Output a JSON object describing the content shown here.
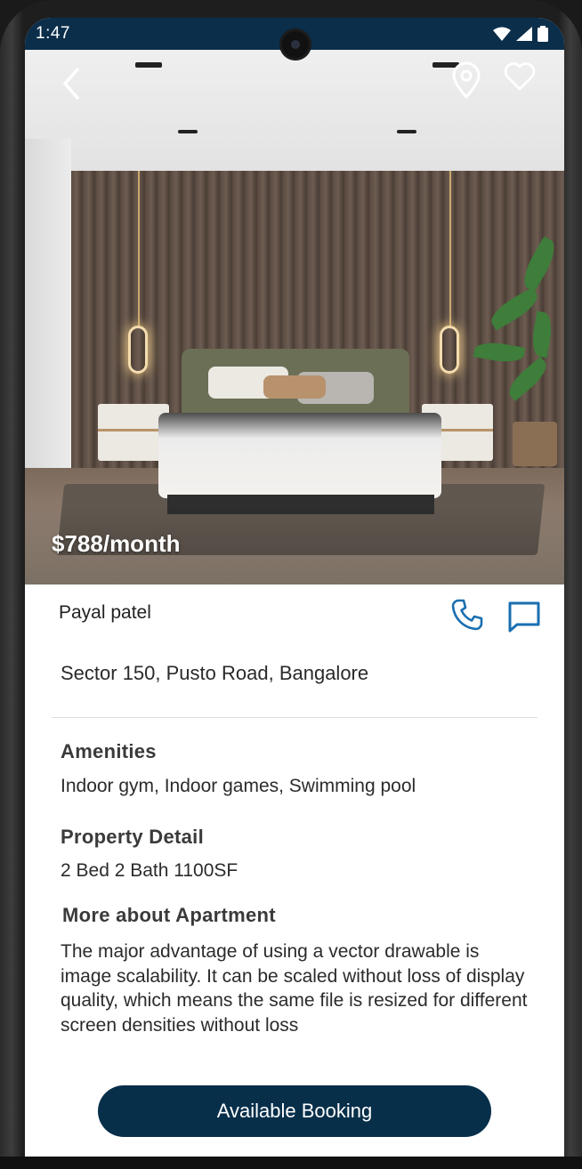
{
  "status_bar": {
    "time": "1:47"
  },
  "property": {
    "price": "$788/month",
    "owner_name": "Payal patel",
    "address": "Sector 150, Pusto Road, Bangalore"
  },
  "sections": {
    "amenities_title": "Amenities",
    "amenities_text": "Indoor gym, Indoor games, Swimming pool",
    "detail_title": "Property Detail",
    "detail_text": "2 Bed 2 Bath 1100SF",
    "about_title": "More about Apartment",
    "about_text": "The major advantage of using a vector drawable is image scalability. It can be scaled without loss of display quality, which means the same file is resized for different screen densities without loss"
  },
  "actions": {
    "booking_label": "Available Booking"
  },
  "icons": {
    "back": "back-arrow-icon",
    "location": "location-pin-icon",
    "favorite": "heart-icon",
    "call": "phone-icon",
    "chat": "chat-icon"
  },
  "colors": {
    "primary": "#072f4a",
    "accent_icon": "#1a6fb0",
    "status_bar": "#0b2e4a"
  }
}
